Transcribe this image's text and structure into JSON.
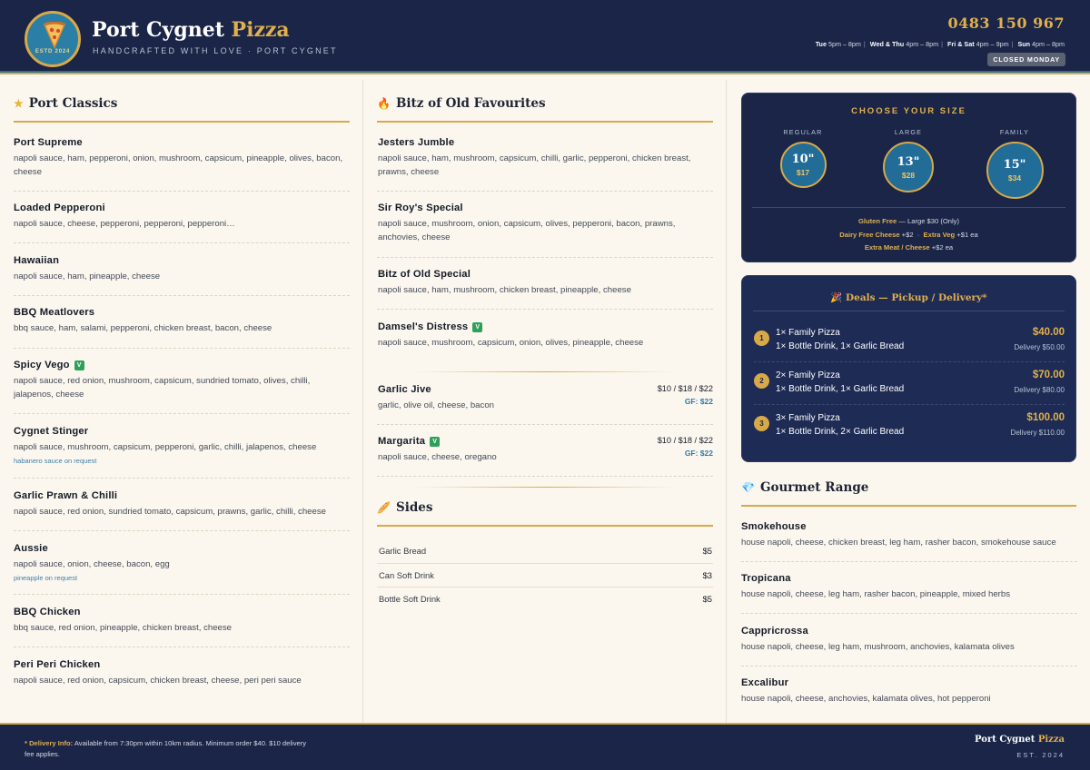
{
  "header": {
    "brand_main": "Port Cygnet",
    "brand_accent": "Pizza",
    "tagline": "HANDCRAFTED WITH LOVE · PORT CYGNET",
    "logo_text": "ESTD 2024",
    "phone": "0483 150 967",
    "hours": [
      {
        "day": "Tue",
        "time": "5pm – 8pm"
      },
      {
        "day": "Wed & Thu",
        "time": "4pm – 8pm"
      },
      {
        "day": "Fri & Sat",
        "time": "4pm – 9pm"
      },
      {
        "day": "Sun",
        "time": "4pm – 8pm"
      }
    ],
    "closed": "CLOSED MONDAY"
  },
  "classics": {
    "title": "Port Classics",
    "items": [
      {
        "name": "Port Supreme",
        "desc": "napoli sauce, ham, pepperoni, onion, mushroom, capsicum, pineapple, olives, bacon, cheese"
      },
      {
        "name": "Loaded Pepperoni",
        "desc": "napoli sauce, cheese, pepperoni, pepperoni, pepperoni…"
      },
      {
        "name": "Hawaiian",
        "desc": "napoli sauce, ham, pineapple, cheese"
      },
      {
        "name": "BBQ Meatlovers",
        "desc": "bbq sauce, ham, salami, pepperoni, chicken breast, bacon, cheese"
      },
      {
        "name": "Spicy Vego",
        "veg": "V",
        "desc": "napoli sauce, red onion, mushroom, capsicum, sundried tomato, olives, chilli, jalapenos, cheese"
      },
      {
        "name": "Cygnet Stinger",
        "desc": "napoli sauce, mushroom, capsicum, pepperoni, garlic, chilli, jalapenos, cheese",
        "note": "habanero sauce on request"
      },
      {
        "name": "Garlic Prawn & Chilli",
        "desc": "napoli sauce, red onion, sundried tomato, capsicum, prawns, garlic, chilli, cheese"
      },
      {
        "name": "Aussie",
        "desc": "napoli sauce, onion, cheese, bacon, egg",
        "note": "pineapple on request"
      },
      {
        "name": "BBQ Chicken",
        "desc": "bbq sauce, red onion, pineapple, chicken breast, cheese"
      },
      {
        "name": "Peri Peri Chicken",
        "desc": "napoli sauce, red onion, capsicum, chicken breast, cheese, peri peri sauce"
      }
    ]
  },
  "favourites": {
    "title": "Bitz of Old Favourites",
    "items": [
      {
        "name": "Jesters Jumble",
        "desc": "napoli sauce, ham, mushroom, capsicum, chilli, garlic, pepperoni, chicken breast, prawns, cheese"
      },
      {
        "name": "Sir Roy's Special",
        "desc": "napoli sauce, mushroom, onion, capsicum, olives, pepperoni, bacon, prawns, anchovies, cheese"
      },
      {
        "name": "Bitz of Old Special",
        "desc": "napoli sauce, ham, mushroom, chicken breast, pineapple, cheese"
      },
      {
        "name": "Damsel's Distress",
        "veg": "V",
        "desc": "napoli sauce, mushroom, capsicum, onion, olives, pineapple, cheese"
      }
    ],
    "priced": [
      {
        "name": "Garlic Jive",
        "desc": "garlic, olive oil, cheese, bacon",
        "price": "$10 / $18 / $22",
        "gf": "GF: $22"
      },
      {
        "name": "Margarita",
        "veg": "V",
        "desc": "napoli sauce, cheese, oregano",
        "price": "$10 / $18 / $22",
        "gf": "GF: $22"
      }
    ]
  },
  "sides": {
    "title": "Sides",
    "items": [
      {
        "name": "Garlic Bread",
        "price": "$5"
      },
      {
        "name": "Can Soft Drink",
        "price": "$3"
      },
      {
        "name": "Bottle Soft Drink",
        "price": "$5"
      }
    ]
  },
  "sizes": {
    "title": "CHOOSE YOUR SIZE",
    "items": [
      {
        "label": "REGULAR",
        "inches": "10\"",
        "price": "$17"
      },
      {
        "label": "LARGE",
        "inches": "13\"",
        "price": "$28"
      },
      {
        "label": "FAMILY",
        "inches": "15\"",
        "price": "$34"
      }
    ],
    "gf_label": "Gluten Free",
    "gf_text": "— Large $30 (Only)",
    "dairy_label": "Dairy Free Cheese",
    "dairy_text": "+$2",
    "veg_label": "Extra Veg",
    "veg_text": "+$1 ea",
    "meat_label": "Extra Meat / Cheese",
    "meat_text": "+$2 ea"
  },
  "deals": {
    "title": "Deals — Pickup / Delivery*",
    "items": [
      {
        "num": "1",
        "line1": "1× Family Pizza",
        "line2": "1× Bottle Drink, 1× Garlic Bread",
        "price": "$40.00",
        "delivery": "Delivery $50.00"
      },
      {
        "num": "2",
        "line1": "2× Family Pizza",
        "line2": "1× Bottle Drink, 1× Garlic Bread",
        "price": "$70.00",
        "delivery": "Delivery $80.00"
      },
      {
        "num": "3",
        "line1": "3× Family Pizza",
        "line2": "1× Bottle Drink, 2× Garlic Bread",
        "price": "$100.00",
        "delivery": "Delivery $110.00"
      }
    ]
  },
  "gourmet": {
    "title": "Gourmet Range",
    "items": [
      {
        "name": "Smokehouse",
        "desc": "house napoli, cheese, chicken breast, leg ham, rasher bacon, smokehouse sauce"
      },
      {
        "name": "Tropicana",
        "desc": "house napoli, cheese, leg ham, rasher bacon, pineapple, mixed herbs"
      },
      {
        "name": "Cappricrossa",
        "desc": "house napoli, cheese, leg ham, mushroom, anchovies, kalamata olives"
      },
      {
        "name": "Excalibur",
        "desc": "house napoli, cheese, anchovies, kalamata olives, hot pepperoni"
      }
    ]
  },
  "footer": {
    "info_label": "* Delivery Info:",
    "info_text": "Available from 7:30pm within 10km radius. Minimum order $40. $10 delivery fee applies.",
    "brand_main": "Port Cygnet",
    "brand_accent": "Pizza",
    "est": "EST. 2024"
  },
  "colors": {
    "navy": "#1a2547",
    "gold": "#d8a948",
    "teal": "#2b7ea6",
    "cream": "#fbf7ef",
    "veg_green": "#2fa05a"
  },
  "icons": {
    "classics": "star-icon",
    "favourites": "fire-icon",
    "sides": "bread-icon",
    "deals": "party-icon",
    "gourmet": "gem-icon",
    "logo": "pizza-slice-icon"
  }
}
